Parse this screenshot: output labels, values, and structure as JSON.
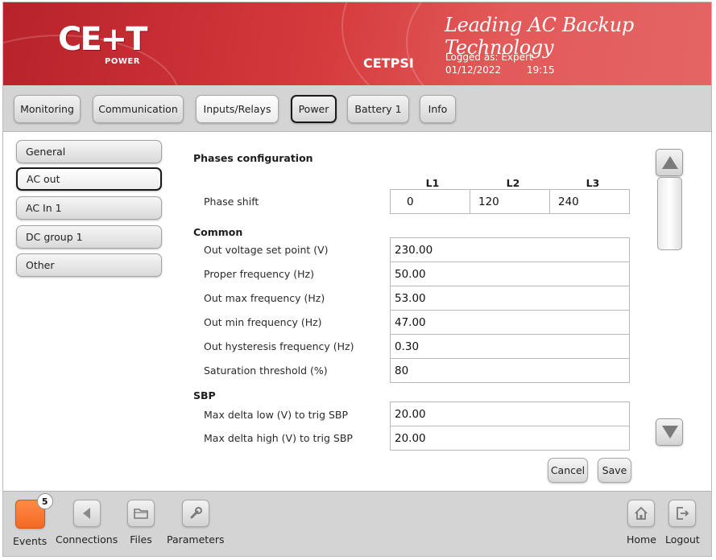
{
  "header": {
    "logo_text": "CE+T",
    "logo_sub": "POWER",
    "tagline": "Leading AC Backup Technology",
    "device_name": "CETPSI",
    "logged_as": "Logged as: Expert",
    "date": "01/12/2022",
    "time": "19:15"
  },
  "tabs": [
    {
      "label": "Monitoring"
    },
    {
      "label": "Communication"
    },
    {
      "label": "Inputs/Relays"
    },
    {
      "label": "Power"
    },
    {
      "label": "Battery 1"
    },
    {
      "label": "Info"
    }
  ],
  "sidebar": {
    "items": [
      {
        "label": "General"
      },
      {
        "label": "AC out"
      },
      {
        "label": "AC In 1"
      },
      {
        "label": "DC group 1"
      },
      {
        "label": "Other"
      }
    ]
  },
  "phases": {
    "title": "Phases configuration",
    "columns": [
      "L1",
      "L2",
      "L3"
    ],
    "row_label": "Phase shift",
    "values": [
      "0",
      "120",
      "240"
    ]
  },
  "common": {
    "title": "Common",
    "rows": [
      {
        "label": "Out voltage set point (V)",
        "value": "230.00"
      },
      {
        "label": "Proper frequency (Hz)",
        "value": "50.00"
      },
      {
        "label": "Out max frequency (Hz)",
        "value": "53.00"
      },
      {
        "label": "Out min frequency (Hz)",
        "value": "47.00"
      },
      {
        "label": "Out hysteresis frequency (Hz)",
        "value": "0.30"
      },
      {
        "label": "Saturation threshold (%)",
        "value": "80"
      }
    ]
  },
  "sbp": {
    "title": "SBP",
    "rows": [
      {
        "label": "Max delta low (V) to trig SBP",
        "value": "20.00"
      },
      {
        "label": "Max delta high (V) to trig SBP",
        "value": "20.00"
      }
    ]
  },
  "actions": {
    "cancel_label": "Cancel",
    "save_label": "Save"
  },
  "footer": {
    "events_count": "5",
    "items": [
      {
        "label": "Events",
        "icon": "events-icon"
      },
      {
        "label": "Connections",
        "icon": "connections-icon"
      },
      {
        "label": "Files",
        "icon": "folder-icon"
      },
      {
        "label": "Parameters",
        "icon": "wrench-icon"
      },
      {
        "label": "Home",
        "icon": "home-icon"
      },
      {
        "label": "Logout",
        "icon": "logout-icon"
      }
    ]
  },
  "colors": {
    "header_red": "#d53a3d",
    "events_orange": "#f26a24",
    "panel_gray": "#d4d4d4"
  }
}
